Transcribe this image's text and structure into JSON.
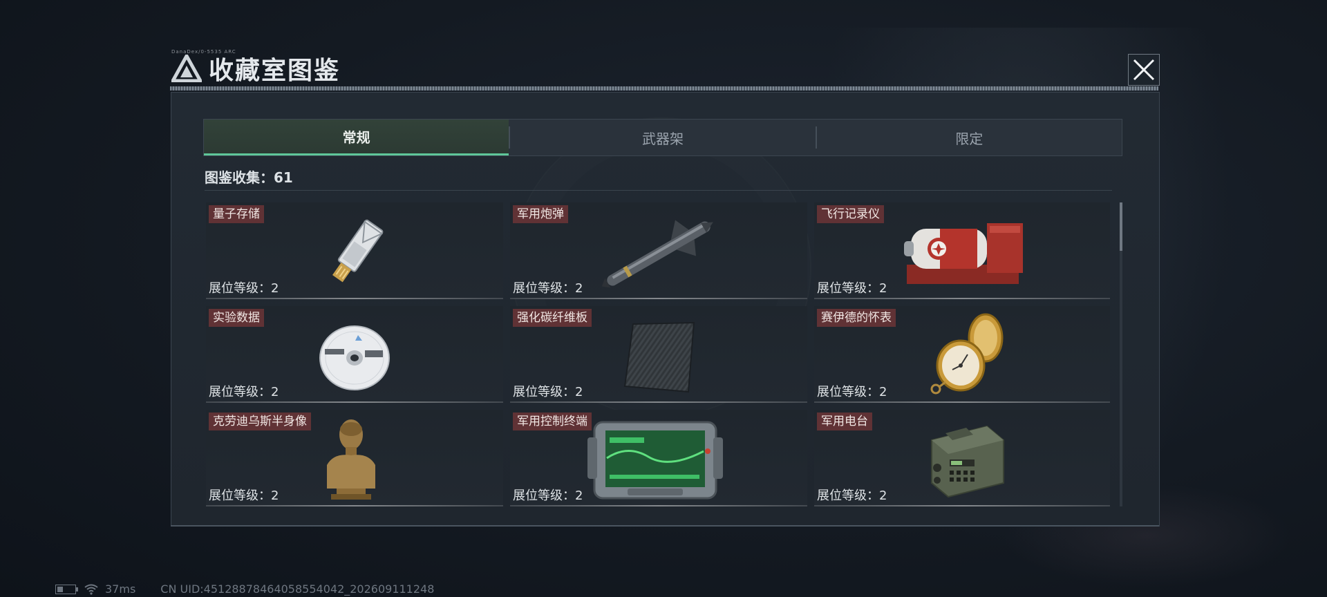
{
  "header": {
    "title": "收藏室图鉴",
    "tiny_code": "DanaDex/0-5535 ARC",
    "close_icon": "close-icon"
  },
  "tabs": [
    {
      "label": "常规",
      "active": true
    },
    {
      "label": "武器架",
      "active": false
    },
    {
      "label": "限定",
      "active": false
    }
  ],
  "collection": {
    "text": "图鉴收集：61"
  },
  "items": [
    {
      "name": "量子存储",
      "level": "展位等级：2",
      "icon": "usb-drive-icon"
    },
    {
      "name": "军用炮弹",
      "level": "展位等级：2",
      "icon": "missile-icon"
    },
    {
      "name": "飞行记录仪",
      "level": "展位等级：2",
      "icon": "flight-recorder-icon"
    },
    {
      "name": "实验数据",
      "level": "展位等级：2",
      "icon": "disc-icon"
    },
    {
      "name": "强化碳纤维板",
      "level": "展位等级：2",
      "icon": "carbon-plate-icon"
    },
    {
      "name": "赛伊德的怀表",
      "level": "展位等级：2",
      "icon": "pocket-watch-icon"
    },
    {
      "name": "克劳迪乌斯半身像",
      "level": "展位等级：2",
      "icon": "bust-icon"
    },
    {
      "name": "军用控制终端",
      "level": "展位等级：2",
      "icon": "control-terminal-icon"
    },
    {
      "name": "军用电台",
      "level": "展位等级：2",
      "icon": "radio-icon"
    }
  ],
  "status": {
    "ping": "37ms",
    "uid": "CN UID:45128878464058554042_202609111248"
  },
  "colors": {
    "accent": "#5fc79a",
    "name_badge": "#963c3c"
  }
}
